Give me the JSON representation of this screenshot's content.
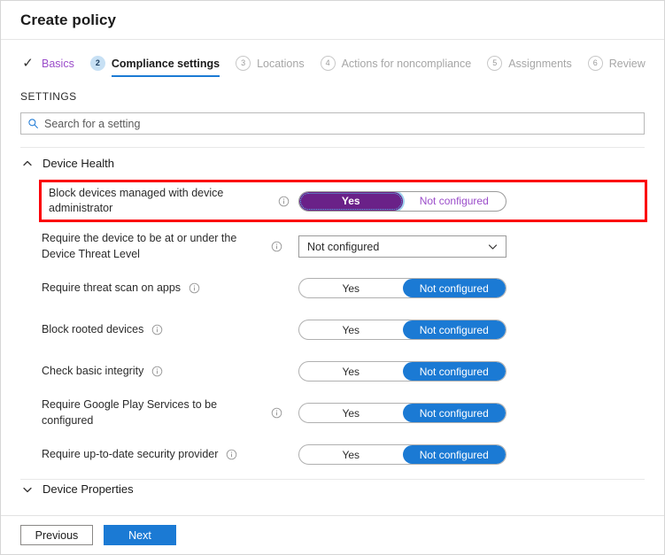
{
  "window": {
    "title": "Create policy"
  },
  "wizard": {
    "steps": [
      {
        "marker": "✓",
        "label": "Basics",
        "state": "done"
      },
      {
        "marker": "2",
        "label": "Compliance settings",
        "state": "current"
      },
      {
        "marker": "3",
        "label": "Locations",
        "state": "upcoming"
      },
      {
        "marker": "4",
        "label": "Actions for noncompliance",
        "state": "upcoming"
      },
      {
        "marker": "5",
        "label": "Assignments",
        "state": "upcoming"
      },
      {
        "marker": "6",
        "label": "Review",
        "state": "upcoming"
      }
    ]
  },
  "settings": {
    "caption": "SETTINGS",
    "search": {
      "placeholder": "Search for a setting",
      "value": "",
      "icon": "search-icon"
    },
    "groups": [
      {
        "title": "Device Health",
        "expanded": true,
        "chevron": "chevron-up-icon",
        "rows": [
          {
            "label": "Block devices managed with device administrator",
            "info": "info-icon",
            "control": "toggle",
            "options": [
              "Yes",
              "Not configured"
            ],
            "selected": "Yes",
            "accent": "purple",
            "highlighted": true,
            "focused": true
          },
          {
            "label": "Require the device to be at or under the Device Threat Level",
            "info": "info-icon",
            "control": "dropdown",
            "value": "Not configured",
            "chevron": "chevron-down-icon",
            "highlighted": false
          },
          {
            "label": "Require threat scan on apps",
            "info": "info-icon",
            "control": "toggle",
            "options": [
              "Yes",
              "Not configured"
            ],
            "selected": "Not configured",
            "accent": "blue",
            "highlighted": false
          },
          {
            "label": "Block rooted devices",
            "info": "info-icon",
            "control": "toggle",
            "options": [
              "Yes",
              "Not configured"
            ],
            "selected": "Not configured",
            "accent": "blue",
            "highlighted": false
          },
          {
            "label": "Check basic integrity",
            "info": "info-icon",
            "control": "toggle",
            "options": [
              "Yes",
              "Not configured"
            ],
            "selected": "Not configured",
            "accent": "blue",
            "highlighted": false
          },
          {
            "label": "Require Google Play Services to be configured",
            "info": "info-icon",
            "control": "toggle",
            "options": [
              "Yes",
              "Not configured"
            ],
            "selected": "Not configured",
            "accent": "blue",
            "highlighted": false
          },
          {
            "label": "Require up-to-date security provider",
            "info": "info-icon",
            "control": "toggle",
            "options": [
              "Yes",
              "Not configured"
            ],
            "selected": "Not configured",
            "accent": "blue",
            "highlighted": false
          }
        ]
      },
      {
        "title": "Device Properties",
        "expanded": false,
        "chevron": "chevron-down-icon",
        "truncated": true,
        "rows": []
      }
    ]
  },
  "footer": {
    "previous_label": "Previous",
    "next_label": "Next"
  },
  "colors": {
    "accent_blue": "#1b7ad4",
    "accent_purple": "#6a2188",
    "link_purple": "#9b4dca",
    "highlight_red": "#fb0007",
    "step_badge_blue": "#c7e0f4"
  }
}
